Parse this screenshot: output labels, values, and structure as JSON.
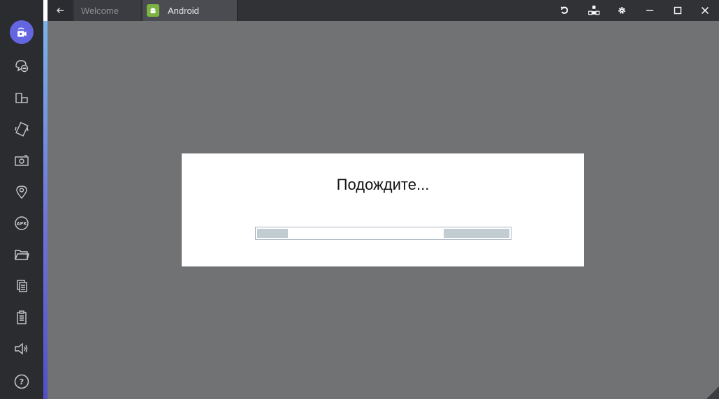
{
  "window": {
    "tabs": [
      {
        "label": "Welcome",
        "active": false
      },
      {
        "label": "Android",
        "active": true
      }
    ],
    "controls": [
      "refresh-icon",
      "multi-instance-icon",
      "gear-icon",
      "minimize-icon",
      "maximize-icon",
      "close-icon"
    ]
  },
  "sidebar": {
    "items": [
      {
        "name": "record-icon",
        "active": true
      },
      {
        "name": "chat-icon"
      },
      {
        "name": "rotate-icon"
      },
      {
        "name": "shake-icon"
      },
      {
        "name": "camera-icon"
      },
      {
        "name": "location-icon"
      },
      {
        "name": "apk-icon",
        "text": "APK"
      },
      {
        "name": "folder-icon"
      },
      {
        "name": "copy-icon"
      },
      {
        "name": "paste-icon"
      },
      {
        "name": "volume-icon"
      },
      {
        "name": "help-icon",
        "text": "?"
      }
    ]
  },
  "dialog": {
    "message": "Подождите..."
  },
  "colors": {
    "sidebar": "#2b2c30",
    "topbar": "#313236",
    "main": "#707273",
    "accent": "#6366e0",
    "progress_fill": "#c2ccd3"
  }
}
